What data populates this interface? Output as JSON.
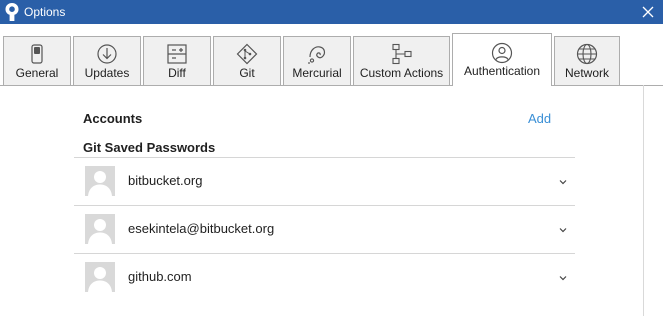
{
  "window": {
    "title": "Options",
    "close_icon": "close-icon",
    "app_icon": "sourcetree-logo-icon",
    "title_bar_color": "#2a5fa8"
  },
  "tabs": [
    {
      "label": "General",
      "icon": "toggle-switch-icon",
      "active": false
    },
    {
      "label": "Updates",
      "icon": "download-circle-icon",
      "active": false
    },
    {
      "label": "Diff",
      "icon": "diff-plus-minus-icon",
      "active": false
    },
    {
      "label": "Git",
      "icon": "git-diamond-icon",
      "active": false
    },
    {
      "label": "Mercurial",
      "icon": "mercurial-icon",
      "active": false
    },
    {
      "label": "Custom Actions",
      "icon": "flowchart-icon",
      "active": false
    },
    {
      "label": "Authentication",
      "icon": "user-circle-icon",
      "active": true
    },
    {
      "label": "Network",
      "icon": "globe-icon",
      "active": false
    }
  ],
  "authentication": {
    "accounts_heading": "Accounts",
    "add_label": "Add",
    "add_color": "#3a8fd6",
    "git_saved_passwords_heading": "Git Saved Passwords",
    "saved_accounts": [
      {
        "label": "bitbucket.org",
        "icon": "default-avatar-icon"
      },
      {
        "label": "esekintela@bitbucket.org",
        "icon": "default-avatar-icon"
      },
      {
        "label": "github.com",
        "icon": "default-avatar-icon"
      }
    ]
  }
}
